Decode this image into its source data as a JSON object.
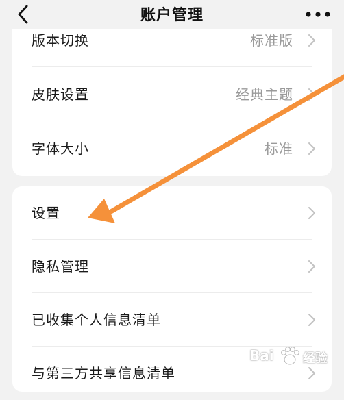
{
  "header": {
    "title": "账户管理"
  },
  "group1": {
    "items": [
      {
        "label": "版本切换",
        "value": "标准版"
      },
      {
        "label": "皮肤设置",
        "value": "经典主题"
      },
      {
        "label": "字体大小",
        "value": "标准"
      }
    ]
  },
  "group2": {
    "items": [
      {
        "label": "设置"
      },
      {
        "label": "隐私管理"
      },
      {
        "label": "已收集个人信息清单"
      },
      {
        "label": "与第三方共享信息清单"
      }
    ]
  },
  "watermark": {
    "brand": "Bai",
    "sub": "经验"
  },
  "colors": {
    "background": "#f2f2f2",
    "card": "#ffffff",
    "annotation_arrow": "#f5913a",
    "secondary_text": "#9a9a9a"
  }
}
